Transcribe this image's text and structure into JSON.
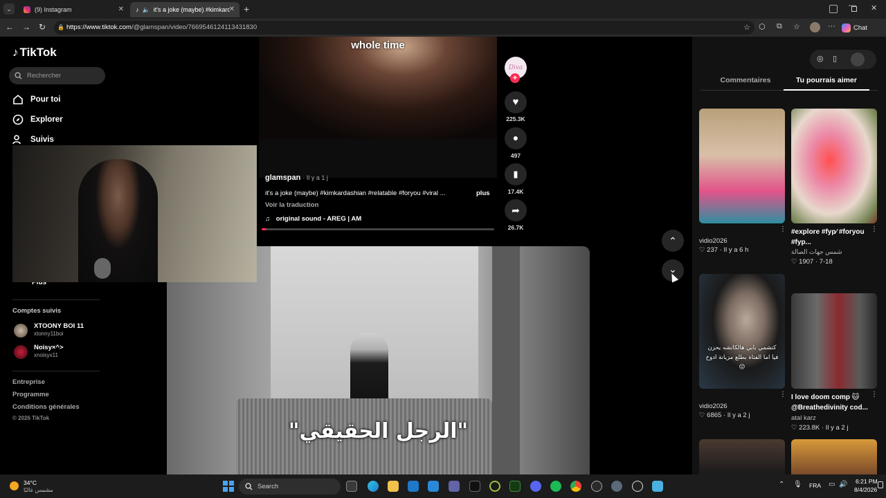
{
  "browser": {
    "tabs": [
      {
        "label": "(9) Instagram"
      },
      {
        "label": "it's a joke (maybe) #kimkarda"
      }
    ],
    "url_host": "https://www.tiktok.com",
    "url_path": "/@glamspan/video/7669546124113431830",
    "chat_label": "Chat"
  },
  "sidebar": {
    "logo": "TikTok",
    "search_placeholder": "Rechercher",
    "nav": [
      {
        "label": "Pour toi"
      },
      {
        "label": "Explorer"
      },
      {
        "label": "Suivis"
      },
      {
        "label": "Plus"
      }
    ],
    "followed_heading": "Comptes suivis",
    "followed": [
      {
        "name": "XTOONY BOI 11",
        "handle": "xtonny11boi"
      },
      {
        "name": "Noisy×^>",
        "handle": "xnoisyx11"
      }
    ],
    "footer": [
      {
        "label": "Entreprise"
      },
      {
        "label": "Programme"
      },
      {
        "label": "Conditions générales"
      }
    ],
    "copyright": "© 2026 TikTok"
  },
  "video": {
    "caption_top": "whole time",
    "author": "glamspan",
    "time": "· Il y a 1 j",
    "description": "it's a joke (maybe) #kimkardashian #relatable #foryou #viral ...",
    "more": "plus",
    "translate": "Voir la traduction",
    "sound": "original sound - AREG | AM",
    "avatar_text": "Diva",
    "likes": "225.3K",
    "comments": "497",
    "saves": "17.4K",
    "shares": "26.7K",
    "next_caption": "\"الرجل الحقيقي\""
  },
  "right_panel": {
    "tabs": [
      {
        "label": "Commentaires"
      },
      {
        "label": "Tu pourrais aimer"
      }
    ],
    "items": [
      {
        "title": "",
        "user": "vidio2026",
        "meta": "♡ 237 · Il y a 6 h",
        "colors": [
          "#b9a07a",
          "#6e5a4a"
        ]
      },
      {
        "title": "#explore #fyp⁄ #foryou #fyp...",
        "user": "شمس جهات الصالة",
        "meta": "♡ 1907 · 7-18",
        "colors": [
          "#e9a0b8",
          "#7a3a2a"
        ]
      },
      {
        "title": "",
        "overlay": "كتشمي بابي هالكاتشه يحزن فيا اما الفتاة بطلع مزيانة ادوخ 😔",
        "user": "vidio2026",
        "meta": "♡ 6865 · Il y a 2 j",
        "colors": [
          "#2a3a48",
          "#b9a89a"
        ]
      },
      {
        "title": "I love doom comp 🐱 @Breathedivinity cod...",
        "user": "atal karz",
        "meta": "♡ 223.8K · Il y a 2 j",
        "colors": [
          "#6a6a6a",
          "#3a3a3a"
        ]
      }
    ]
  },
  "taskbar": {
    "weather_temp": "34°C",
    "weather_desc": "مشمس غالبًا",
    "search": "Search",
    "lang": "FRA",
    "time": "6:21 PM",
    "date": "8/4/2026"
  },
  "colors": {
    "accent": "#fe2c55",
    "panel": "#121212",
    "chrome": "#1f1f1f"
  }
}
